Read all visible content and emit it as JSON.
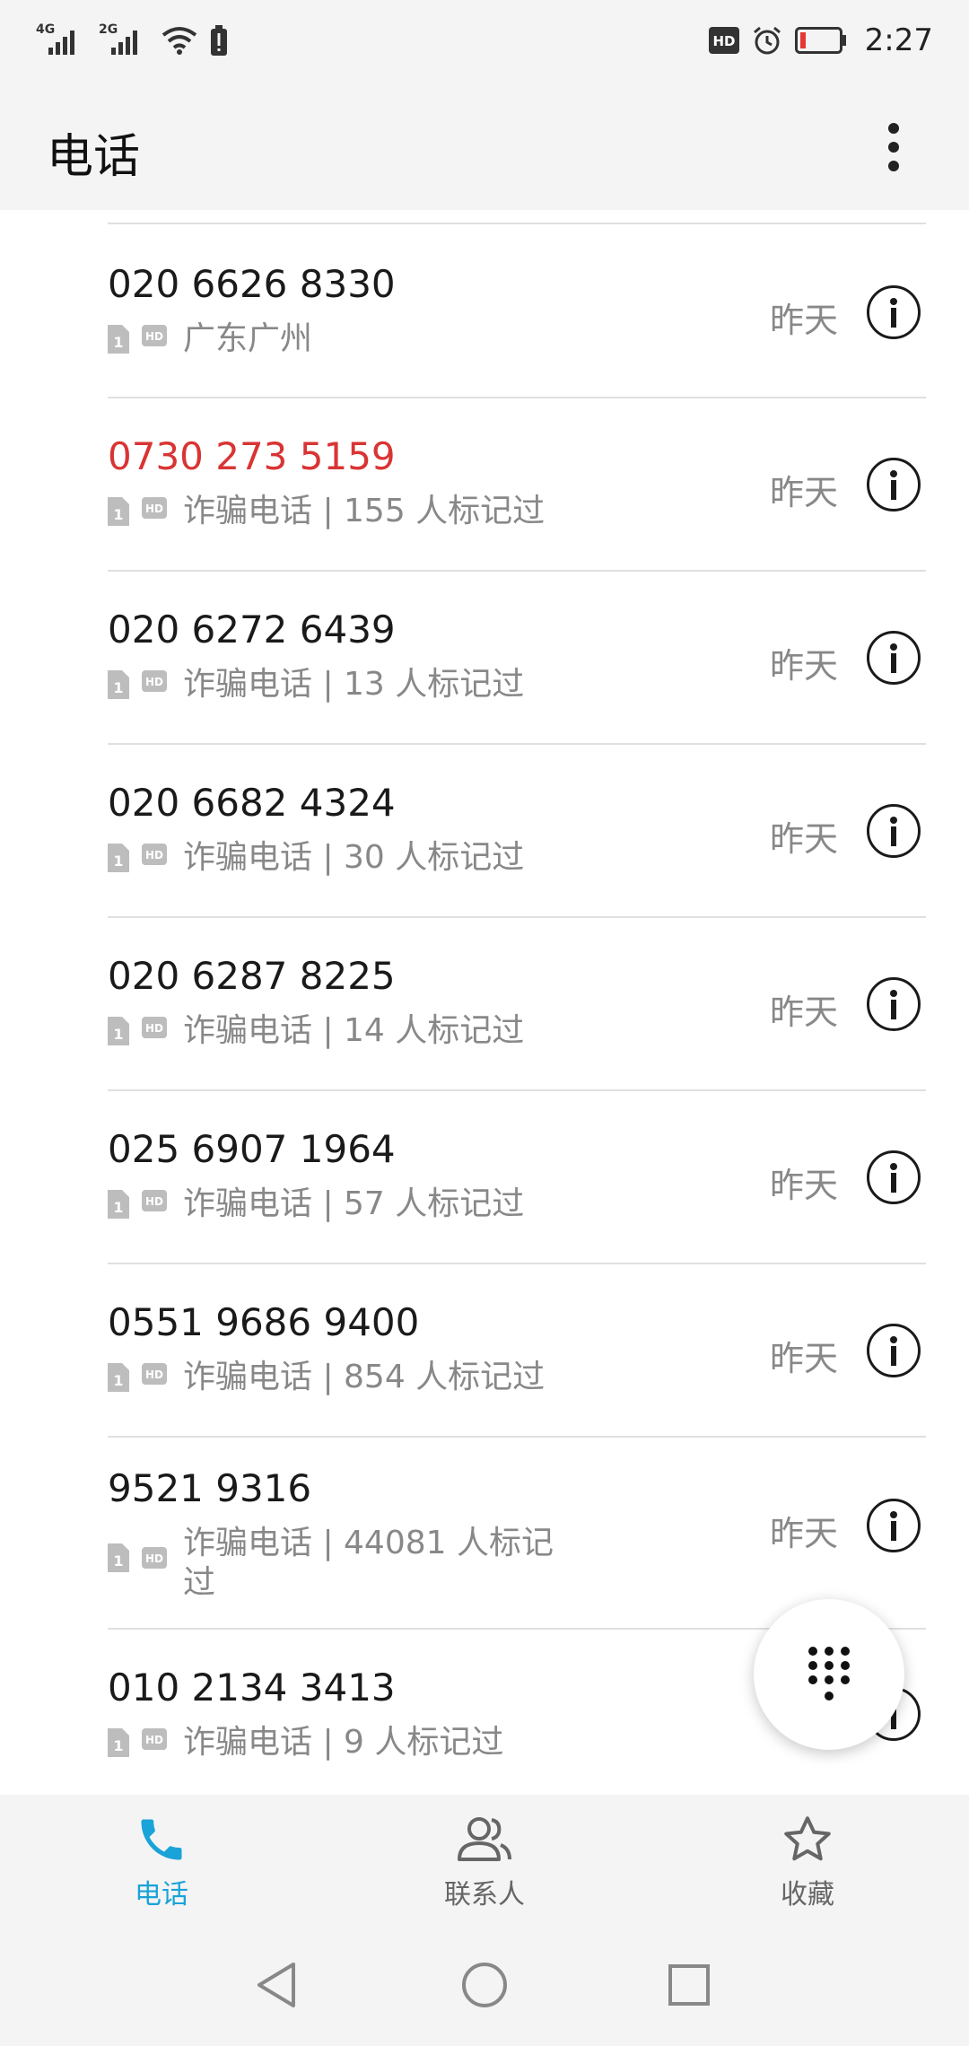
{
  "status_bar": {
    "net1": "4G",
    "net2": "2G",
    "hd_badge": "HD",
    "time": "2:27",
    "battery_color": "#e53935"
  },
  "app_bar": {
    "title": "电话"
  },
  "calls": [
    {
      "number": "020 6626 8330",
      "desc": "广东广州",
      "time": "昨天",
      "missed": false
    },
    {
      "number": "0730 273 5159",
      "desc": "诈骗电话 | 155 人标记过",
      "time": "昨天",
      "missed": true
    },
    {
      "number": "020 6272 6439",
      "desc": "诈骗电话 | 13 人标记过",
      "time": "昨天",
      "missed": false
    },
    {
      "number": "020 6682 4324",
      "desc": "诈骗电话 | 30 人标记过",
      "time": "昨天",
      "missed": false
    },
    {
      "number": "020 6287 8225",
      "desc": "诈骗电话 | 14 人标记过",
      "time": "昨天",
      "missed": false
    },
    {
      "number": "025 6907 1964",
      "desc": "诈骗电话 | 57 人标记过",
      "time": "昨天",
      "missed": false
    },
    {
      "number": "0551 9686 9400",
      "desc": "诈骗电话 | 854 人标记过",
      "time": "昨天",
      "missed": false
    },
    {
      "number": "9521 9316",
      "desc": "诈骗电话 | 44081 人标记过",
      "time": "昨天",
      "missed": false
    },
    {
      "number": "010 2134 3413",
      "desc": "诈骗电话 | 9 人标记过",
      "time": "",
      "missed": false
    }
  ],
  "bottom_nav": {
    "phone": "电话",
    "contacts": "联系人",
    "favorites": "收藏"
  },
  "colors": {
    "accent": "#1aa3d9",
    "missed": "#d93434"
  }
}
